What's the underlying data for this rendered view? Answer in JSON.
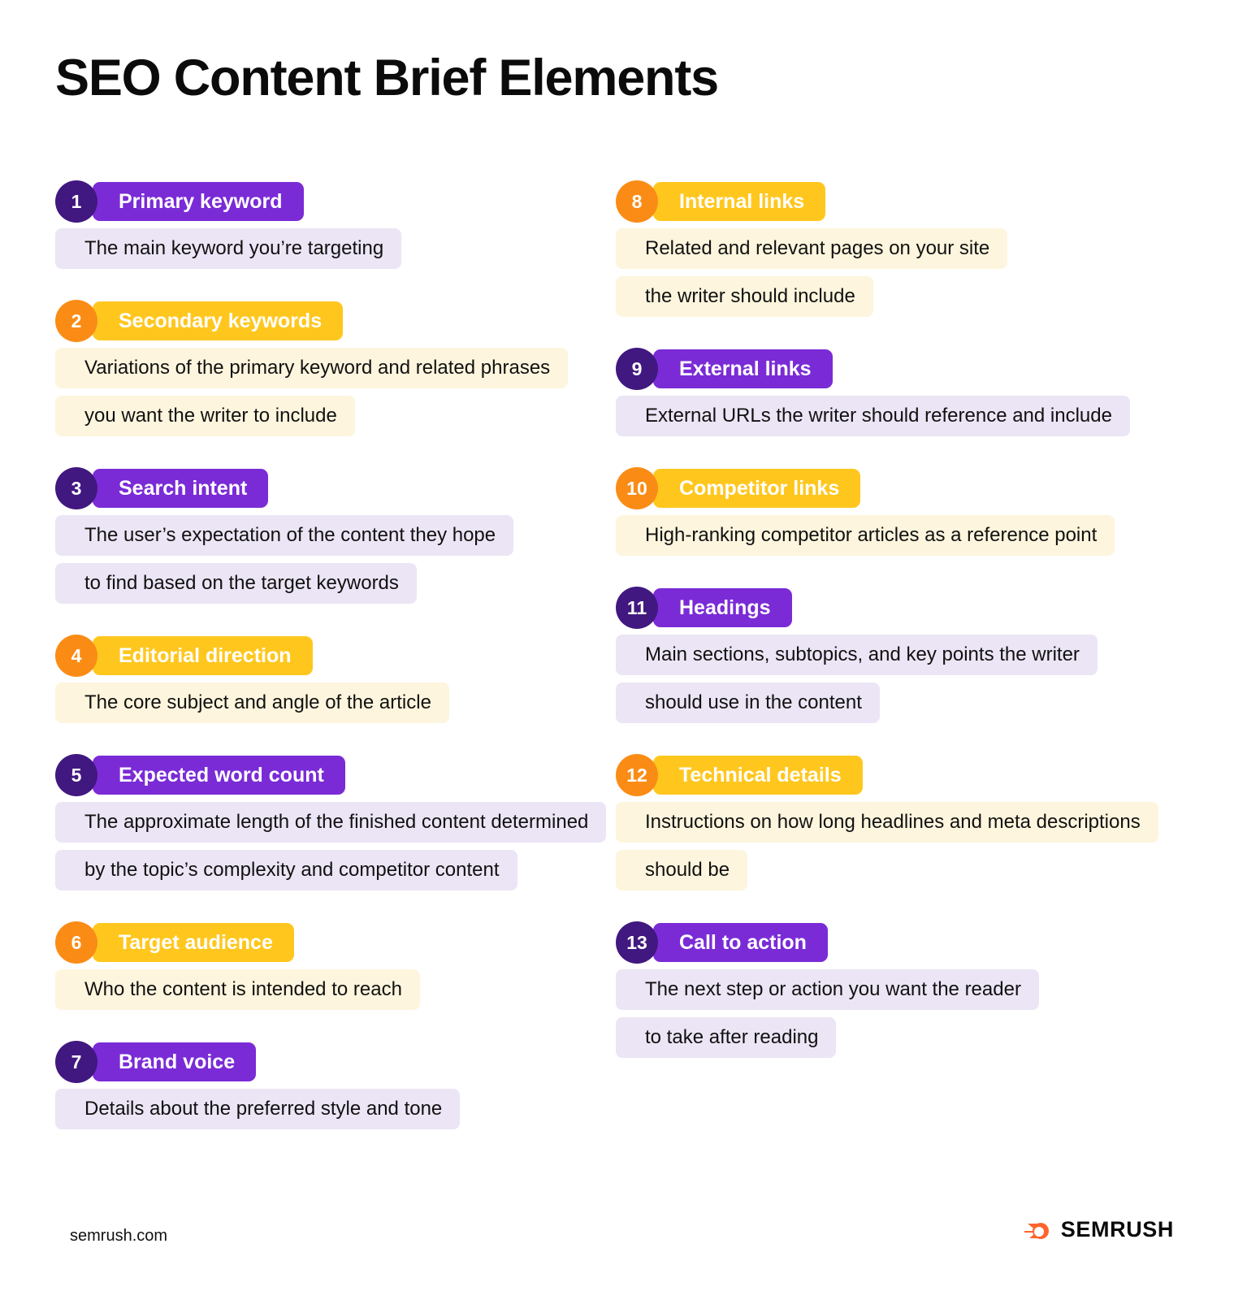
{
  "title": "SEO Content Brief Elements",
  "colors": {
    "purple_circle": "#41187f",
    "purple_pill": "#7a2bd6",
    "purple_desc": "#ebe5f5",
    "orange_circle": "#fa8c16",
    "yellow_pill": "#ffc71e",
    "cream_desc": "#fdf5dd",
    "brand_orange": "#ff642d",
    "text": "#111111"
  },
  "columns": {
    "left": [
      {
        "number": "1",
        "label": "Primary keyword",
        "theme": "purple",
        "description_lines": [
          "The main keyword you’re targeting"
        ]
      },
      {
        "number": "2",
        "label": "Secondary keywords",
        "theme": "orange",
        "description_lines": [
          "Variations of the primary keyword and related phrases",
          "you want the writer to include"
        ]
      },
      {
        "number": "3",
        "label": "Search intent",
        "theme": "purple",
        "description_lines": [
          "The user’s expectation of the content they hope",
          "to find based on the target keywords"
        ]
      },
      {
        "number": "4",
        "label": "Editorial direction",
        "theme": "orange",
        "description_lines": [
          "The core subject and angle of the article"
        ]
      },
      {
        "number": "5",
        "label": "Expected word count",
        "theme": "purple",
        "description_lines": [
          "The approximate length of the finished content determined",
          "by the topic’s complexity and competitor content"
        ]
      },
      {
        "number": "6",
        "label": "Target audience",
        "theme": "orange",
        "description_lines": [
          "Who the content is intended to reach"
        ]
      },
      {
        "number": "7",
        "label": "Brand voice",
        "theme": "purple",
        "description_lines": [
          "Details about the preferred style and tone"
        ]
      }
    ],
    "right": [
      {
        "number": "8",
        "label": "Internal links",
        "theme": "orange",
        "description_lines": [
          "Related and relevant pages on your site",
          "the writer should include"
        ]
      },
      {
        "number": "9",
        "label": "External links",
        "theme": "purple",
        "description_lines": [
          "External URLs the writer should reference and include"
        ]
      },
      {
        "number": "10",
        "label": "Competitor links",
        "theme": "orange",
        "description_lines": [
          "High-ranking competitor articles as a reference point"
        ]
      },
      {
        "number": "11",
        "label": "Headings",
        "theme": "purple",
        "description_lines": [
          "Main sections, subtopics, and key points the writer",
          "should use in the content"
        ]
      },
      {
        "number": "12",
        "label": "Technical details",
        "theme": "orange",
        "description_lines": [
          "Instructions on how long headlines and meta descriptions",
          "should be"
        ]
      },
      {
        "number": "13",
        "label": "Call to action",
        "theme": "purple",
        "description_lines": [
          "The next step or action you want the reader",
          "to take after reading"
        ]
      }
    ]
  },
  "footer": {
    "url": "semrush.com",
    "brand_name": "SEMRUSH"
  }
}
